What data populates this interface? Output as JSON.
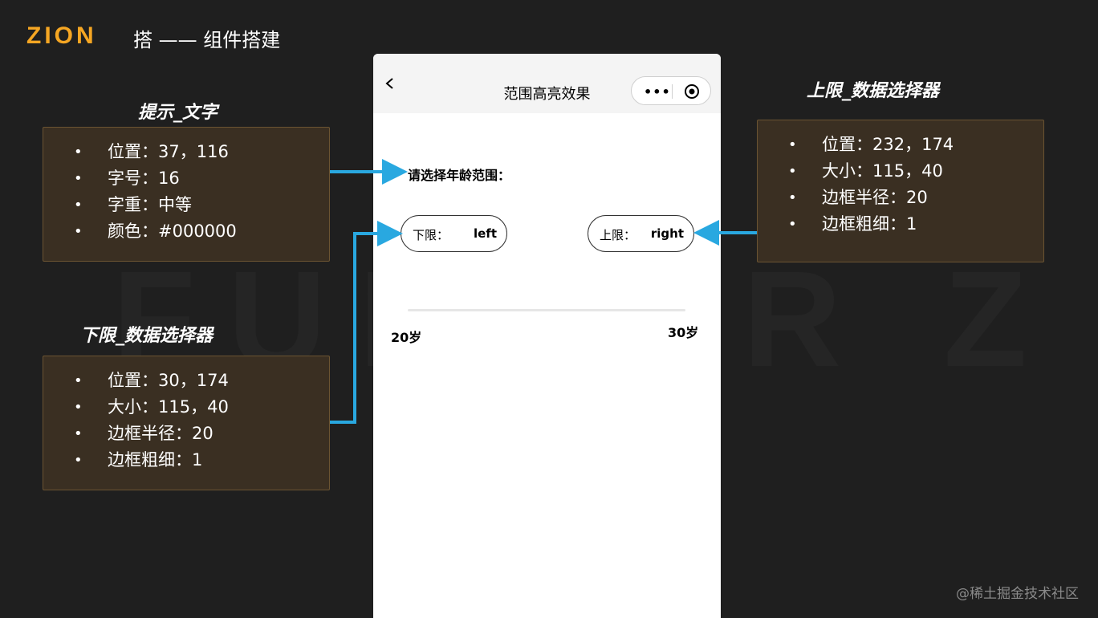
{
  "header": {
    "logo": "ZION",
    "title": "搭 —— 组件搭建"
  },
  "watermark": "FUNDER Z",
  "sections": {
    "hint_text": {
      "title": "提示_文字",
      "items": [
        "位置：37，116",
        "字号：16",
        "字重：中等",
        "颜色：#000000"
      ]
    },
    "lower_picker": {
      "title": "下限_数据选择器",
      "items": [
        "位置：30，174",
        "大小：115，40",
        "边框半径：20",
        "边框粗细：1"
      ]
    },
    "upper_picker": {
      "title": "上限_数据选择器",
      "items": [
        "位置：232，174",
        "大小：115，40",
        "边框半径：20",
        "边框粗细：1"
      ]
    }
  },
  "phone": {
    "nav_title": "范围高亮效果",
    "capsule_dots": "•••",
    "prompt": "请选择年龄范围：",
    "lower": {
      "label": "下限：",
      "value": "left"
    },
    "upper": {
      "label": "上限：",
      "value": "right"
    },
    "min_age": "20岁",
    "max_age": "30岁"
  },
  "credit": "@稀土掘金技术社区",
  "colors": {
    "background": "#1f1f1f",
    "logo": "#f5a623",
    "panel_bg": "#3a2f22",
    "panel_border": "#6b5432",
    "connector": "#29a8e0"
  }
}
